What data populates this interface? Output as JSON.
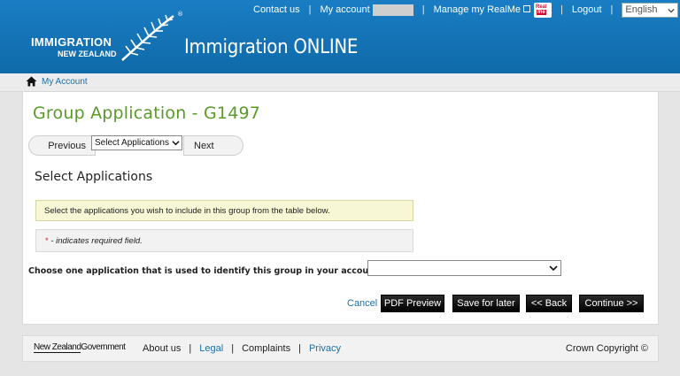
{
  "header": {
    "logo_line1": "IMMIGRATION",
    "logo_line2": "NEW ZEALAND",
    "registered": "®",
    "app_title": "Immigration ONLINE",
    "top_links": {
      "contact": "Contact us",
      "account": "My account",
      "manage_realme": "Manage my RealMe",
      "logout": "Logout",
      "separator": "|"
    },
    "realme_logo": {
      "line1": "Real",
      "line2": "me"
    },
    "language": "English"
  },
  "breadcrumb": {
    "icon": "home-icon",
    "label": "My Account"
  },
  "page": {
    "title": "Group Application - G1497",
    "stepnav": {
      "previous": "Previous",
      "select_value": "Select Applications",
      "next": "Next"
    },
    "section_title": "Select Applications",
    "info_text": "Select the applications you wish to include in this group from the table below.",
    "required_star": "*",
    "required_text": "- indicates required field.",
    "choose_label": "Choose one application that is used to identify this group in your account",
    "choose_value": ""
  },
  "actions": {
    "cancel": "Cancel",
    "pdf_preview": "PDF Preview",
    "save_for_later": "Save for later",
    "back": "<< Back",
    "continue": "Continue >>"
  },
  "footer": {
    "nzgov_a": "New Zealand",
    "nzgov_b": "Government",
    "about": "About us",
    "legal": "Legal",
    "complaints": "Complaints",
    "privacy": "Privacy",
    "separator": "|",
    "copyright": "Crown Copyright ©"
  },
  "colors": {
    "header_blue": "#1a7dc3",
    "title_green": "#5a9a28",
    "link_blue": "#1d6ea8",
    "required_red": "#d21f1f"
  }
}
